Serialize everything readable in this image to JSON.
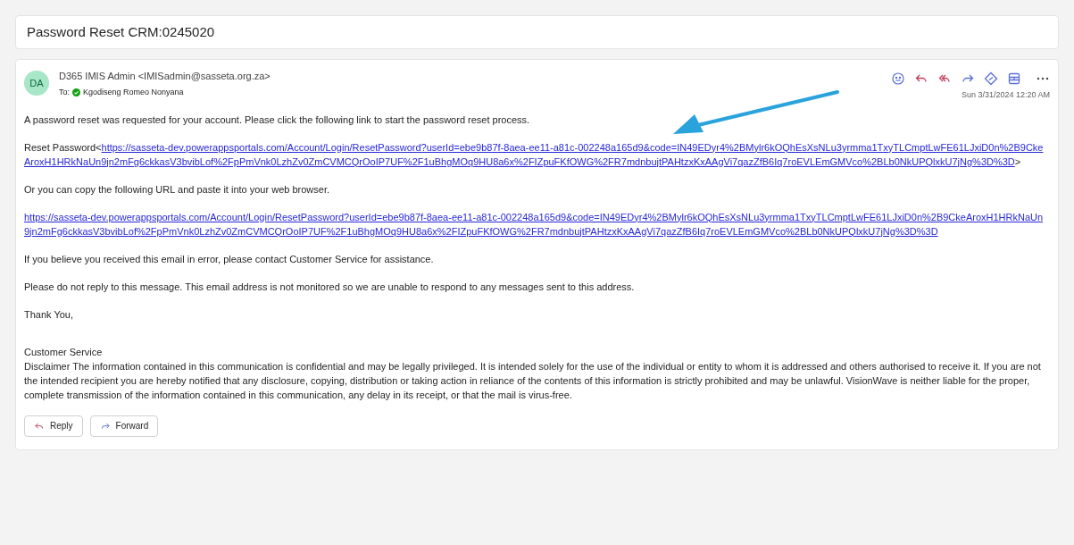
{
  "subject": "Password Reset CRM:0245020",
  "message": {
    "avatar": "DA",
    "sender": "D365 IMIS Admin <IMISadmin@sasseta.org.za>",
    "to_label": "To:",
    "recipient": "Kgodiseng Romeo Nonyana",
    "date": "Sun 3/31/2024 12:20 AM",
    "paragraphs": [
      {
        "kind": "text",
        "text": "A password reset was requested for your account. Please click the following link to start the password reset process."
      },
      {
        "kind": "link",
        "before": "Reset Password<",
        "link": "https://sasseta-dev.powerappsportals.com/Account/Login/ResetPassword?userId=ebe9b87f-8aea-ee11-a81c-002248a165d9&code=IN49EDyr4%2BMylr6kOQhEsXsNLu3yrmma1TxyTLCmptLwFE61LJxiD0n%2B9CkeAroxH1HRkNaUn9jn2mFg6ckkasV3bvibLof%2FpPmVnk0LzhZv0ZmCVMCQrOoIP7UF%2F1uBhgMOq9HU8a6x%2FIZpuFKfOWG%2FR7mdnbujtPAHtzxKxAAgVi7qazZfB6Iq7roEVLEmGMVco%2BLb0NkUPQlxkU7jNg%3D%3D",
        "after": ">"
      },
      {
        "kind": "text",
        "text": "Or you can copy the following URL and paste it into your web browser."
      },
      {
        "kind": "link",
        "link": "https://sasseta-dev.powerappsportals.com/Account/Login/ResetPassword?userId=ebe9b87f-8aea-ee11-a81c-002248a165d9&code=IN49EDyr4%2BMylr6kOQhEsXsNLu3yrmma1TxyTLCmptLwFE61LJxiD0n%2B9CkeAroxH1HRkNaUn9jn2mFg6ckkasV3bvibLof%2FpPmVnk0LzhZv0ZmCVMCQrOoIP7UF%2F1uBhgMOq9HU8a6x%2FIZpuFKfOWG%2FR7mdnbujtPAHtzxKxAAgVi7qazZfB6Iq7roEVLEmGMVco%2BLb0NkUPQlxkU7jNg%3D%3D"
      },
      {
        "kind": "text",
        "text": "If you believe you received this email in error, please contact Customer Service for assistance."
      },
      {
        "kind": "text",
        "text": "Please do not reply to this message. This email address is not monitored so we are unable to respond to any messages sent to this address."
      },
      {
        "kind": "text",
        "text": "Thank You,"
      }
    ],
    "signature": "Customer Service",
    "disclaimer": "Disclaimer The information contained in this communication is confidential and may be legally privileged. It is intended solely for the use of the individual or entity to whom it is addressed and others authorised to receive it. If you are not the intended recipient you are hereby notified that any disclosure, copying, distribution or taking action in reliance of the contents of this information is strictly prohibited and may be unlawful. VisionWave is neither liable for the proper, complete transmission of the information contained in this communication, any delay in its receipt, or that the mail is virus-free."
  },
  "actions": [
    "Reply",
    "Forward"
  ]
}
